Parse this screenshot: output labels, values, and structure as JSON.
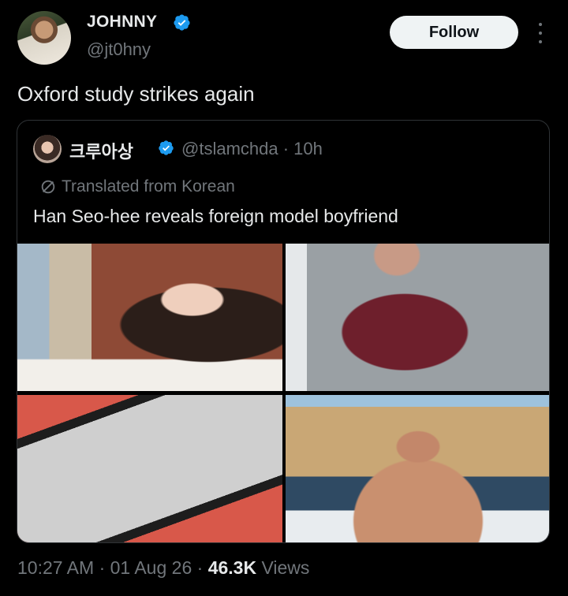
{
  "author": {
    "display_name": "JOHNNY",
    "handle": "@jt0hny",
    "verified": true,
    "avatar_icon": "profile-photo"
  },
  "actions": {
    "follow_label": "Follow",
    "more_icon": "more-vertical-icon"
  },
  "tweet": {
    "text": "Oxford study strikes again"
  },
  "quoted": {
    "display_name": "크루아상",
    "verified": true,
    "meta": "@tslamchda · 10h",
    "translated_label": "Translated from Korean",
    "text": "Han Seo-hee reveals foreign model boyfriend",
    "images": [
      {
        "icon": "photo"
      },
      {
        "icon": "photo"
      },
      {
        "icon": "photo"
      },
      {
        "icon": "photo"
      }
    ]
  },
  "footer": {
    "time": "10:27 AM",
    "date": "01 Aug 26",
    "views_count": "46.3K",
    "views_label": "Views"
  },
  "colors": {
    "background": "#000000",
    "text": "#e7e9ea",
    "muted": "#71767b",
    "verified": "#1d9bf0",
    "border": "#2f3336"
  }
}
